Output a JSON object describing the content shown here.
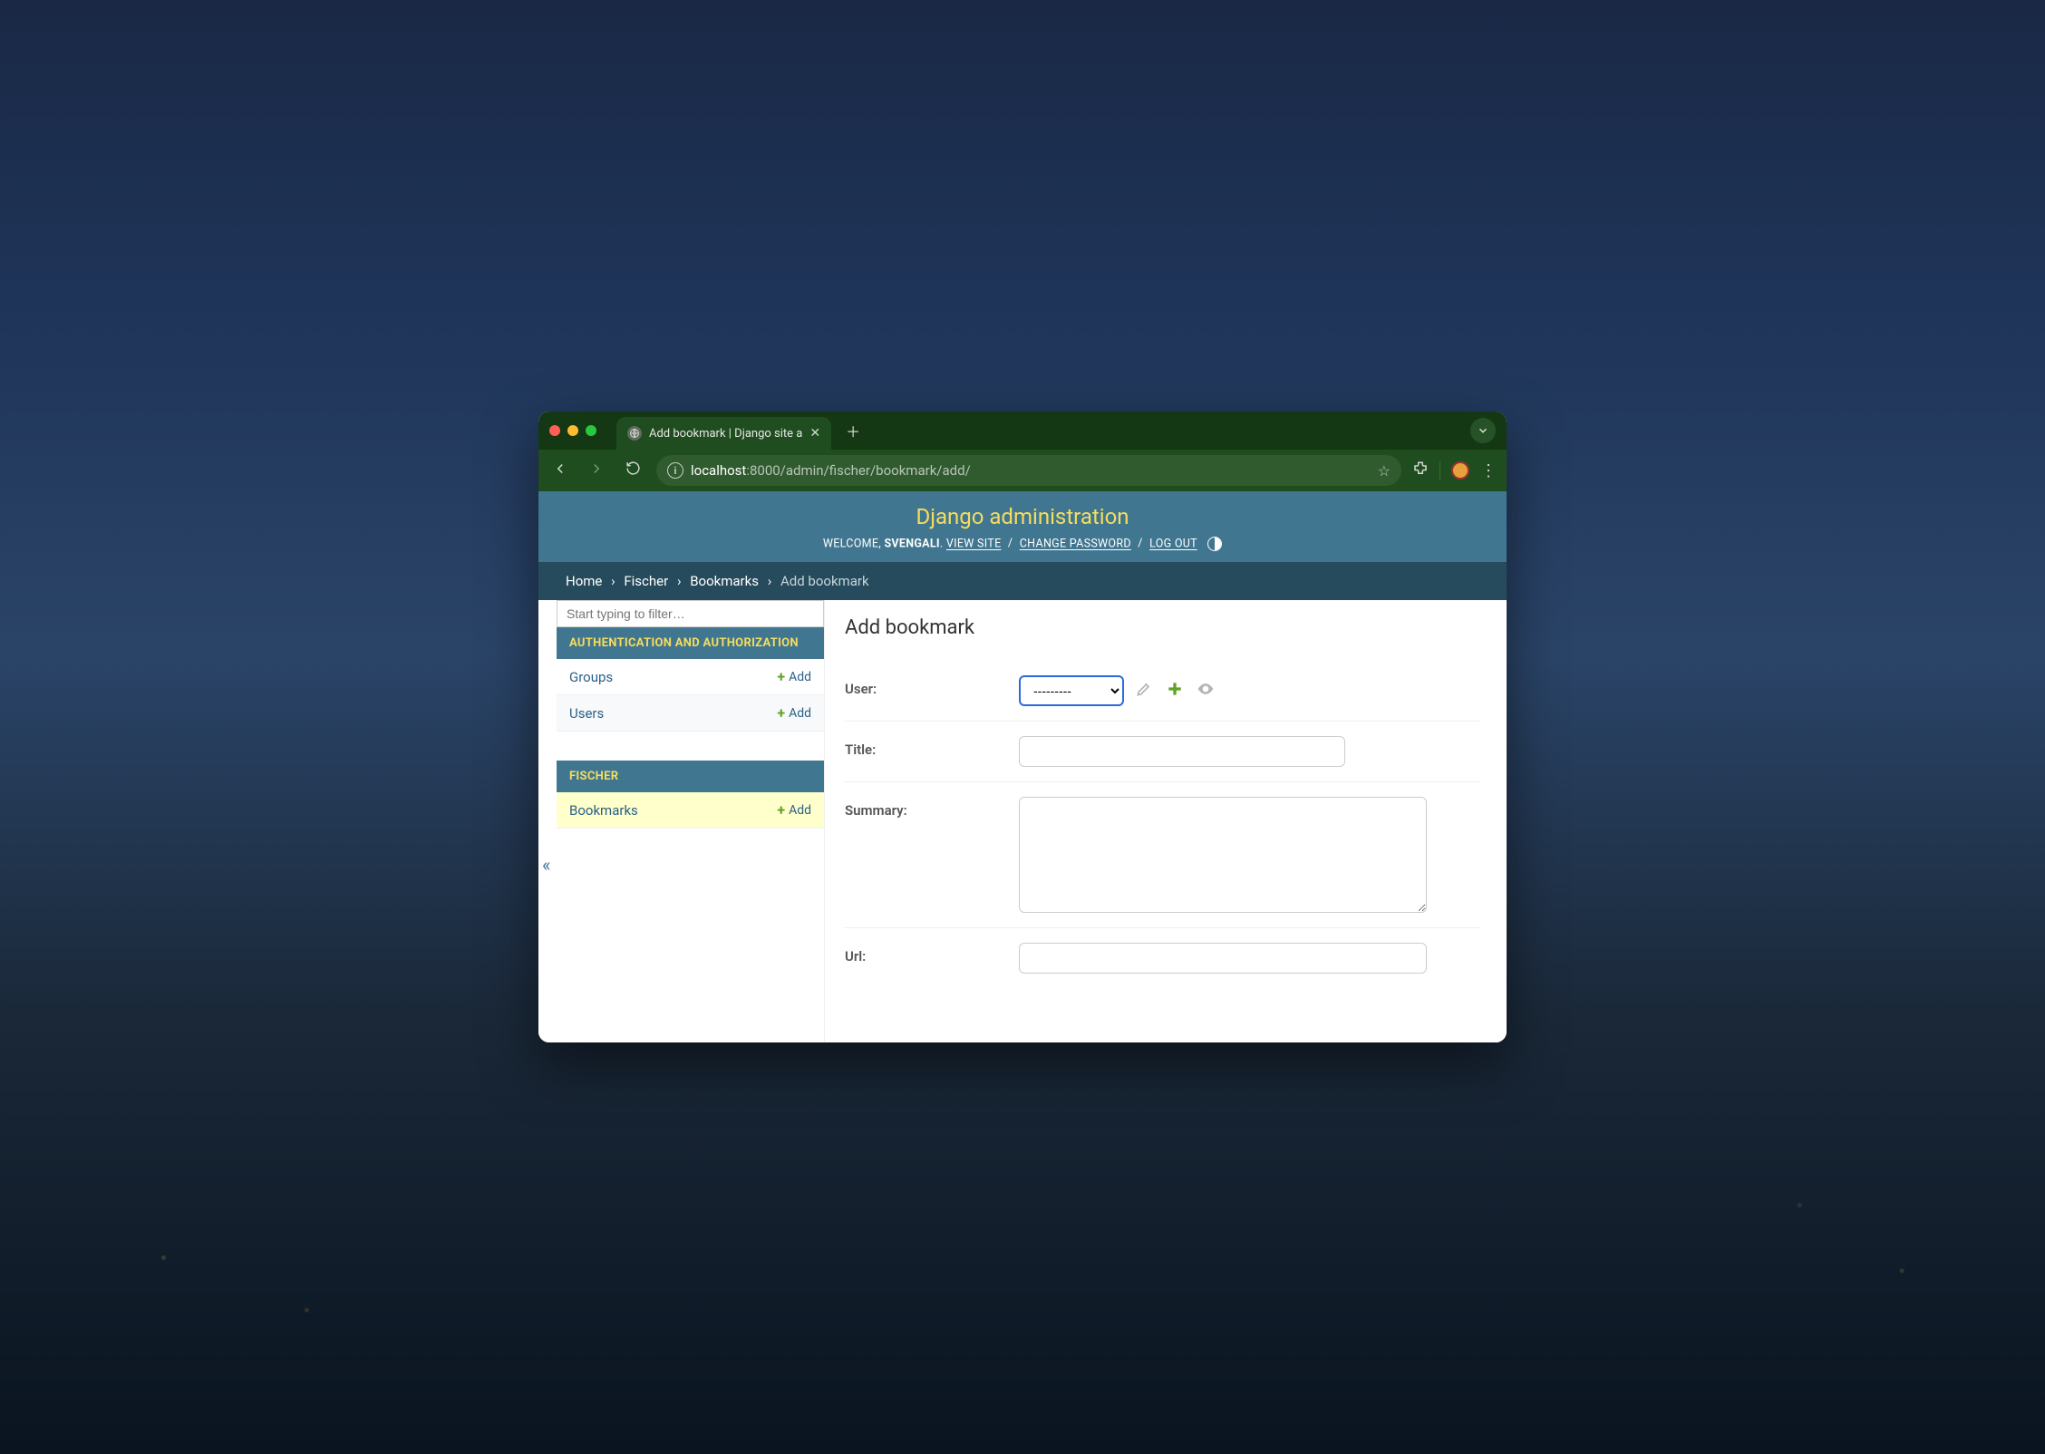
{
  "browser": {
    "tab_title": "Add bookmark | Django site a",
    "url_host": "localhost",
    "url_path": ":8000/admin/fischer/bookmark/add/"
  },
  "header": {
    "title": "Django administration",
    "welcome": "WELCOME,",
    "username": "SVENGALI",
    "view_site": "VIEW SITE",
    "change_password": "CHANGE PASSWORD",
    "log_out": "LOG OUT"
  },
  "breadcrumbs": {
    "home": "Home",
    "app": "Fischer",
    "model": "Bookmarks",
    "current": "Add bookmark"
  },
  "sidebar": {
    "filter_placeholder": "Start typing to filter…",
    "auth_caption": "AUTHENTICATION AND AUTHORIZATION",
    "groups": "Groups",
    "users": "Users",
    "app_caption": "FISCHER",
    "bookmarks": "Bookmarks",
    "add": "Add"
  },
  "content": {
    "title": "Add bookmark",
    "user_label": "User:",
    "user_selected": "---------",
    "title_label": "Title:",
    "summary_label": "Summary:",
    "url_label": "Url:"
  }
}
